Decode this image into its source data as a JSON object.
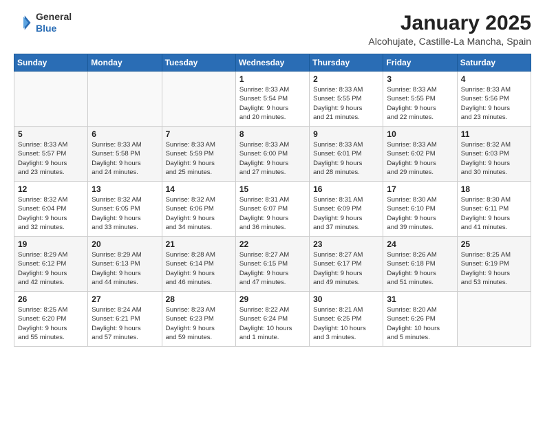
{
  "logo": {
    "general": "General",
    "blue": "Blue"
  },
  "header": {
    "title": "January 2025",
    "subtitle": "Alcohujate, Castille-La Mancha, Spain"
  },
  "weekdays": [
    "Sunday",
    "Monday",
    "Tuesday",
    "Wednesday",
    "Thursday",
    "Friday",
    "Saturday"
  ],
  "weeks": [
    [
      {
        "day": "",
        "info": ""
      },
      {
        "day": "",
        "info": ""
      },
      {
        "day": "",
        "info": ""
      },
      {
        "day": "1",
        "info": "Sunrise: 8:33 AM\nSunset: 5:54 PM\nDaylight: 9 hours\nand 20 minutes."
      },
      {
        "day": "2",
        "info": "Sunrise: 8:33 AM\nSunset: 5:55 PM\nDaylight: 9 hours\nand 21 minutes."
      },
      {
        "day": "3",
        "info": "Sunrise: 8:33 AM\nSunset: 5:55 PM\nDaylight: 9 hours\nand 22 minutes."
      },
      {
        "day": "4",
        "info": "Sunrise: 8:33 AM\nSunset: 5:56 PM\nDaylight: 9 hours\nand 23 minutes."
      }
    ],
    [
      {
        "day": "5",
        "info": "Sunrise: 8:33 AM\nSunset: 5:57 PM\nDaylight: 9 hours\nand 23 minutes."
      },
      {
        "day": "6",
        "info": "Sunrise: 8:33 AM\nSunset: 5:58 PM\nDaylight: 9 hours\nand 24 minutes."
      },
      {
        "day": "7",
        "info": "Sunrise: 8:33 AM\nSunset: 5:59 PM\nDaylight: 9 hours\nand 25 minutes."
      },
      {
        "day": "8",
        "info": "Sunrise: 8:33 AM\nSunset: 6:00 PM\nDaylight: 9 hours\nand 27 minutes."
      },
      {
        "day": "9",
        "info": "Sunrise: 8:33 AM\nSunset: 6:01 PM\nDaylight: 9 hours\nand 28 minutes."
      },
      {
        "day": "10",
        "info": "Sunrise: 8:33 AM\nSunset: 6:02 PM\nDaylight: 9 hours\nand 29 minutes."
      },
      {
        "day": "11",
        "info": "Sunrise: 8:32 AM\nSunset: 6:03 PM\nDaylight: 9 hours\nand 30 minutes."
      }
    ],
    [
      {
        "day": "12",
        "info": "Sunrise: 8:32 AM\nSunset: 6:04 PM\nDaylight: 9 hours\nand 32 minutes."
      },
      {
        "day": "13",
        "info": "Sunrise: 8:32 AM\nSunset: 6:05 PM\nDaylight: 9 hours\nand 33 minutes."
      },
      {
        "day": "14",
        "info": "Sunrise: 8:32 AM\nSunset: 6:06 PM\nDaylight: 9 hours\nand 34 minutes."
      },
      {
        "day": "15",
        "info": "Sunrise: 8:31 AM\nSunset: 6:07 PM\nDaylight: 9 hours\nand 36 minutes."
      },
      {
        "day": "16",
        "info": "Sunrise: 8:31 AM\nSunset: 6:09 PM\nDaylight: 9 hours\nand 37 minutes."
      },
      {
        "day": "17",
        "info": "Sunrise: 8:30 AM\nSunset: 6:10 PM\nDaylight: 9 hours\nand 39 minutes."
      },
      {
        "day": "18",
        "info": "Sunrise: 8:30 AM\nSunset: 6:11 PM\nDaylight: 9 hours\nand 41 minutes."
      }
    ],
    [
      {
        "day": "19",
        "info": "Sunrise: 8:29 AM\nSunset: 6:12 PM\nDaylight: 9 hours\nand 42 minutes."
      },
      {
        "day": "20",
        "info": "Sunrise: 8:29 AM\nSunset: 6:13 PM\nDaylight: 9 hours\nand 44 minutes."
      },
      {
        "day": "21",
        "info": "Sunrise: 8:28 AM\nSunset: 6:14 PM\nDaylight: 9 hours\nand 46 minutes."
      },
      {
        "day": "22",
        "info": "Sunrise: 8:27 AM\nSunset: 6:15 PM\nDaylight: 9 hours\nand 47 minutes."
      },
      {
        "day": "23",
        "info": "Sunrise: 8:27 AM\nSunset: 6:17 PM\nDaylight: 9 hours\nand 49 minutes."
      },
      {
        "day": "24",
        "info": "Sunrise: 8:26 AM\nSunset: 6:18 PM\nDaylight: 9 hours\nand 51 minutes."
      },
      {
        "day": "25",
        "info": "Sunrise: 8:25 AM\nSunset: 6:19 PM\nDaylight: 9 hours\nand 53 minutes."
      }
    ],
    [
      {
        "day": "26",
        "info": "Sunrise: 8:25 AM\nSunset: 6:20 PM\nDaylight: 9 hours\nand 55 minutes."
      },
      {
        "day": "27",
        "info": "Sunrise: 8:24 AM\nSunset: 6:21 PM\nDaylight: 9 hours\nand 57 minutes."
      },
      {
        "day": "28",
        "info": "Sunrise: 8:23 AM\nSunset: 6:23 PM\nDaylight: 9 hours\nand 59 minutes."
      },
      {
        "day": "29",
        "info": "Sunrise: 8:22 AM\nSunset: 6:24 PM\nDaylight: 10 hours\nand 1 minute."
      },
      {
        "day": "30",
        "info": "Sunrise: 8:21 AM\nSunset: 6:25 PM\nDaylight: 10 hours\nand 3 minutes."
      },
      {
        "day": "31",
        "info": "Sunrise: 8:20 AM\nSunset: 6:26 PM\nDaylight: 10 hours\nand 5 minutes."
      },
      {
        "day": "",
        "info": ""
      }
    ]
  ]
}
